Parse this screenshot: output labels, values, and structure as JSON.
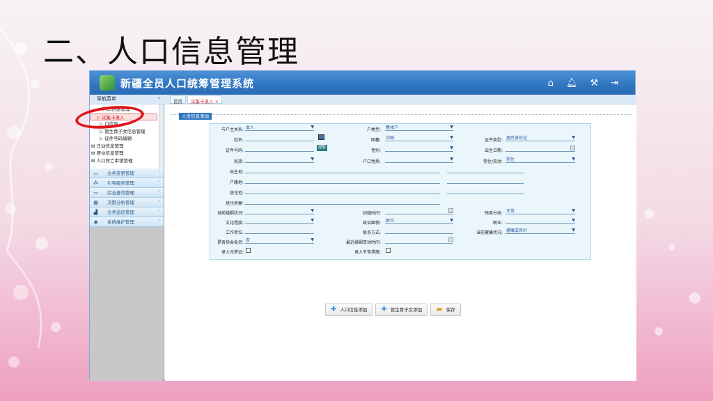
{
  "slide": {
    "title": "二、人口信息管理"
  },
  "app": {
    "title": "新疆全员人口统筹管理系统",
    "header_icons": [
      "home-icon",
      "bell-icon",
      "wrench-icon",
      "logout-icon"
    ]
  },
  "nav": {
    "title": "导航菜单",
    "close": "«",
    "tabs": [
      {
        "label": "首页"
      },
      {
        "label": "采集卡录入 ×"
      }
    ]
  },
  "sidebar": {
    "tree": [
      {
        "label": "- 人口信息管理"
      },
      {
        "label": "▷ 采集卡录入"
      },
      {
        "label": "▷ 口信息"
      },
      {
        "label": "▷ 管生育子女信息管理"
      },
      {
        "label": "▷ 证件号码编辑"
      },
      {
        "label": "⊞ 迁动信息管理"
      },
      {
        "label": "⊞ 居住信息管理"
      },
      {
        "label": "⊞ 人口死亡审销管理"
      }
    ],
    "menus": [
      {
        "label": "业务变更管理",
        "icon": "▭"
      },
      {
        "label": "引导服务管理",
        "icon": "⁂"
      },
      {
        "label": "综合查询管理",
        "icon": "▭"
      },
      {
        "label": "决策分析管理",
        "icon": "▦"
      },
      {
        "label": "业务监控管理",
        "icon": "▟"
      },
      {
        "label": "系统维护管理",
        "icon": "◉"
      }
    ]
  },
  "form": {
    "section": "人员信息添加",
    "relation_label": "与户主关系:",
    "relation_value": "本人",
    "hukou_type_label": "户类型:",
    "hukou_type_value": "集体户",
    "name_label": "姓名:",
    "nation_label": "国籍:",
    "nation_value": "中国",
    "cert_type_label": "证件类型:",
    "cert_type_value": "居民身份证",
    "cert_no_label": "证件号码:",
    "cert_btn": "提取",
    "gender_label": "性别:",
    "birthdate_label": "出生日期:",
    "ethnic_label": "民族:",
    "hukou_nature_label": "户口性质:",
    "resident_label": "常住/流动:",
    "resident_value": "常住",
    "birthplace_label": "出生地:",
    "registered_label": "户籍地:",
    "residence_label": "居住地:",
    "residence_house_label": "居住房屋:",
    "marriage_label": "当前婚姻状况:",
    "first_marriage_label": "初婚时间:",
    "disability_label": "残疾分类:",
    "disability_value": "正常",
    "education_label": "文化程度:",
    "political_label": "政治面貌:",
    "political_value": "群众",
    "occupation_label": "职业:",
    "workplace_label": "工作单位:",
    "contact_label": "联系方式:",
    "health_label": "当前健康状况:",
    "health_value": "健康或良好",
    "association_label": "是否协会会员:",
    "association_value": "否",
    "recent_marriage_label": "最近婚姻变动时间:",
    "glory_label": "录入光荣证:",
    "birth_control_label": "录入节育措施:"
  },
  "actions": {
    "add_person": "人口信息添加",
    "add_child": "管生育子女添加",
    "save": "保存"
  }
}
